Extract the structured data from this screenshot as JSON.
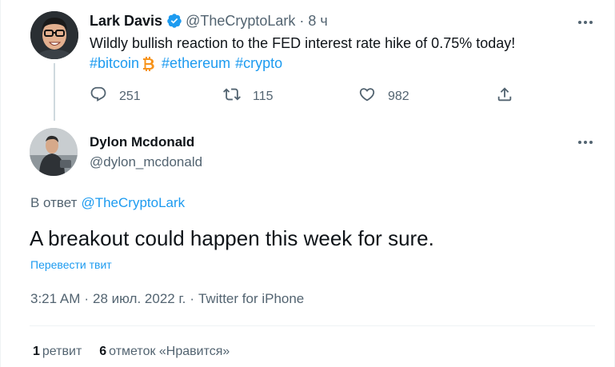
{
  "parent_tweet": {
    "author_name": "Lark Davis",
    "handle": "@TheCryptoLark",
    "dot": "·",
    "time": "8 ч",
    "text": "Wildly bullish reaction to the FED interest rate hike of 0.75% today!",
    "hashtags": [
      "#bitcoin",
      "#ethereum",
      "#crypto"
    ],
    "reply_count": "251",
    "retweet_count": "115",
    "like_count": "982",
    "icons": {
      "avatar": "avatar-photo",
      "verified": "verified-badge-icon",
      "bitcoin": "bitcoin-emoji-icon",
      "more": "more-options-icon",
      "reply": "reply-icon",
      "retweet": "retweet-icon",
      "like": "heart-icon",
      "share": "share-icon"
    }
  },
  "focused_tweet": {
    "author_name": "Dylon Mcdonald",
    "handle": "@dylon_mcdonald",
    "reply_prefix": "В ответ",
    "reply_to": "@TheCryptoLark",
    "text": "A breakout could happen this week for sure.",
    "translate_label": "Перевести твит",
    "time": "3:21 AM",
    "sep": "·",
    "date": "28 июл. 2022 г.",
    "source": "Twitter for iPhone",
    "retweets_count": "1",
    "retweets_label": "ретвит",
    "likes_count": "6",
    "likes_label": "отметок «Нравится»"
  },
  "colors": {
    "accent": "#1d9bf0",
    "text_primary": "#0f1419",
    "text_secondary": "#536471",
    "border": "#eff3f4",
    "bitcoin": "#f7931a"
  }
}
